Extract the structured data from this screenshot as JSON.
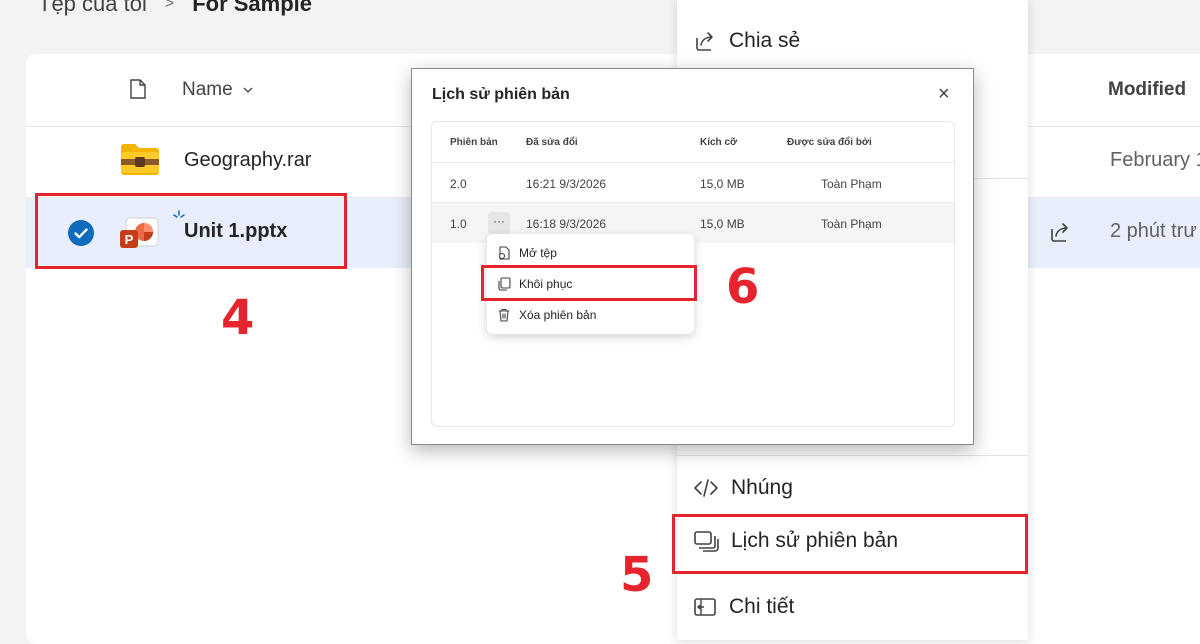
{
  "breadcrumb": {
    "parent": "Tệp của tôi",
    "separator": ">",
    "current": "For Sample"
  },
  "file_list": {
    "columns": {
      "name": "Name",
      "modified": "Modified"
    },
    "rows": [
      {
        "name": "Geography.rar",
        "modified": "February 1",
        "icon": "zip-folder-icon"
      },
      {
        "name": "Unit 1.pptx",
        "modified": "2 phút trư",
        "icon": "powerpoint-icon",
        "selected": true
      }
    ]
  },
  "context_menu": {
    "items": [
      {
        "label": "Chia sẻ",
        "icon": "share-icon"
      },
      {
        "label": "Nhúng",
        "icon": "code-icon"
      },
      {
        "label": "Lịch sử phiên bản",
        "icon": "version-history-icon"
      },
      {
        "label": "Chi tiết",
        "icon": "details-icon"
      }
    ]
  },
  "dialog": {
    "title": "Lịch sử phiên bản",
    "close": "×",
    "columns": [
      "Phiên bản",
      "Đã sửa đổi",
      "Kích cỡ",
      "Được sửa đổi bởi"
    ],
    "rows": [
      {
        "version": "2.0",
        "modified": "16:21 9/3/2026",
        "size": "15,0 MB",
        "by": "Toàn Phạm"
      },
      {
        "version": "1.0",
        "modified": "16:18 9/3/2026",
        "size": "15,0 MB",
        "by": "Toàn Phạm",
        "more": "···"
      }
    ],
    "row_menu": [
      {
        "label": "Mở tệp",
        "icon": "open-file-icon"
      },
      {
        "label": "Khôi phục",
        "icon": "restore-icon"
      },
      {
        "label": "Xóa phiên bản",
        "icon": "delete-icon"
      }
    ]
  },
  "annotations": {
    "step4": "4",
    "step5": "5",
    "step6": "6"
  },
  "colors": {
    "accent": "#0f6cbd",
    "annotation": "#e5242d",
    "selected_row": "#e8eefb"
  }
}
